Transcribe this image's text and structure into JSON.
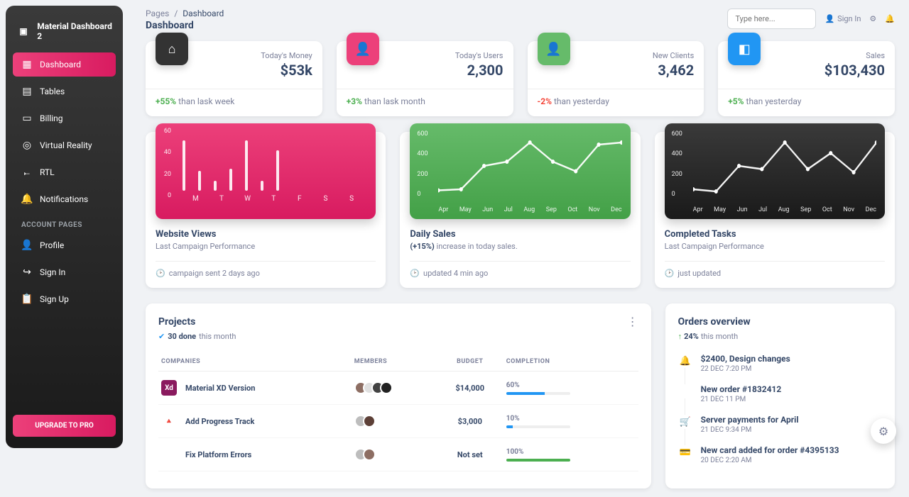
{
  "brand": "Material Dashboard 2",
  "sidebar": {
    "items": [
      {
        "label": "Dashboard",
        "icon": "▦"
      },
      {
        "label": "Tables",
        "icon": "▤"
      },
      {
        "label": "Billing",
        "icon": "▭"
      },
      {
        "label": "Virtual Reality",
        "icon": "◎"
      },
      {
        "label": "RTL",
        "icon": "𐎚"
      },
      {
        "label": "Notifications",
        "icon": "🔔"
      }
    ],
    "section": "ACCOUNT PAGES",
    "account": [
      {
        "label": "Profile",
        "icon": "👤"
      },
      {
        "label": "Sign In",
        "icon": "↪"
      },
      {
        "label": "Sign Up",
        "icon": "📋"
      }
    ],
    "upgrade": "UPGRADE TO PRO"
  },
  "breadcrumb": {
    "root": "Pages",
    "sep": "/",
    "current": "Dashboard"
  },
  "title": "Dashboard",
  "search_placeholder": "Type here...",
  "signin": "Sign In",
  "stats": [
    {
      "label": "Today's Money",
      "value": "$53k",
      "change": "+55%",
      "changeClass": "pos",
      "suffix": " than lask week"
    },
    {
      "label": "Today's Users",
      "value": "2,300",
      "change": "+3%",
      "changeClass": "pos",
      "suffix": " than lask month"
    },
    {
      "label": "New Clients",
      "value": "3,462",
      "change": "-2%",
      "changeClass": "neg",
      "suffix": " than yesterday"
    },
    {
      "label": "Sales",
      "value": "$103,430",
      "change": "+5%",
      "changeClass": "pos",
      "suffix": " than yesterday"
    }
  ],
  "charts": [
    {
      "title": "Website Views",
      "sub": "Last Campaign Performance",
      "footer": "campaign sent 2 days ago"
    },
    {
      "title": "Daily Sales",
      "sub": "(+15%) increase in today sales.",
      "footer": "updated 4 min ago"
    },
    {
      "title": "Completed Tasks",
      "sub": "Last Campaign Performance",
      "footer": "just updated"
    }
  ],
  "chart_data": [
    {
      "type": "bar",
      "categories": [
        "M",
        "T",
        "W",
        "T",
        "F",
        "S",
        "S"
      ],
      "values": [
        50,
        20,
        10,
        22,
        50,
        10,
        40
      ],
      "ylim": [
        0,
        60
      ],
      "yticks": [
        "60",
        "40",
        "20",
        "0"
      ]
    },
    {
      "type": "line",
      "x": [
        "Apr",
        "May",
        "Jun",
        "Jul",
        "Aug",
        "Sep",
        "Oct",
        "Nov",
        "Dec"
      ],
      "values": [
        50,
        60,
        280,
        320,
        500,
        320,
        230,
        480,
        500
      ],
      "ylim": [
        0,
        600
      ],
      "yticks": [
        "600",
        "400",
        "200",
        "0"
      ]
    },
    {
      "type": "line",
      "x": [
        "Apr",
        "May",
        "Jun",
        "Jul",
        "Aug",
        "Sep",
        "Oct",
        "Nov",
        "Dec"
      ],
      "values": [
        60,
        40,
        280,
        250,
        500,
        250,
        400,
        220,
        500
      ],
      "ylim": [
        0,
        600
      ],
      "yticks": [
        "600",
        "400",
        "200",
        "0"
      ]
    }
  ],
  "projects": {
    "title": "Projects",
    "done_count": "30 done",
    "done_suffix": " this month",
    "columns": [
      "COMPANIES",
      "MEMBERS",
      "BUDGET",
      "COMPLETION"
    ],
    "rows": [
      {
        "name": "Material XD Version",
        "icon_bg": "#8a1a5e",
        "icon_tx": "Xd",
        "members": [
          "#8d6e63",
          "#e0e0e0",
          "#424242",
          "#212121"
        ],
        "budget": "$14,000",
        "pct": "60%",
        "pct_w": 60,
        "fill": "blue"
      },
      {
        "name": "Add Progress Track",
        "icon_bg": "transparent",
        "icon_tx": "🔺",
        "members": [
          "#bdbdbd",
          "#5d4037"
        ],
        "budget": "$3,000",
        "pct": "10%",
        "pct_w": 10,
        "fill": "blue"
      },
      {
        "name": "Fix Platform Errors",
        "icon_bg": "transparent",
        "icon_tx": "⬢",
        "members": [
          "#bdbdbd",
          "#8d6e63"
        ],
        "budget": "Not set",
        "pct": "100%",
        "pct_w": 100,
        "fill": "green"
      }
    ]
  },
  "orders": {
    "title": "Orders overview",
    "pct": "24%",
    "suffix": " this month",
    "items": [
      {
        "icon": "🔔",
        "color": "#4caf50",
        "title": "$2400, Design changes",
        "date": "22 DEC 7:20 PM"
      },
      {
        "icon": "</>",
        "color": "#f44336",
        "title": "New order #1832412",
        "date": "21 DEC 11 PM"
      },
      {
        "icon": "🛒",
        "color": "#2196f3",
        "title": "Server payments for April",
        "date": "21 DEC 9:34 PM"
      },
      {
        "icon": "💳",
        "color": "#ff9800",
        "title": "New card added for order #4395133",
        "date": "20 DEC 2:20 AM"
      }
    ]
  }
}
